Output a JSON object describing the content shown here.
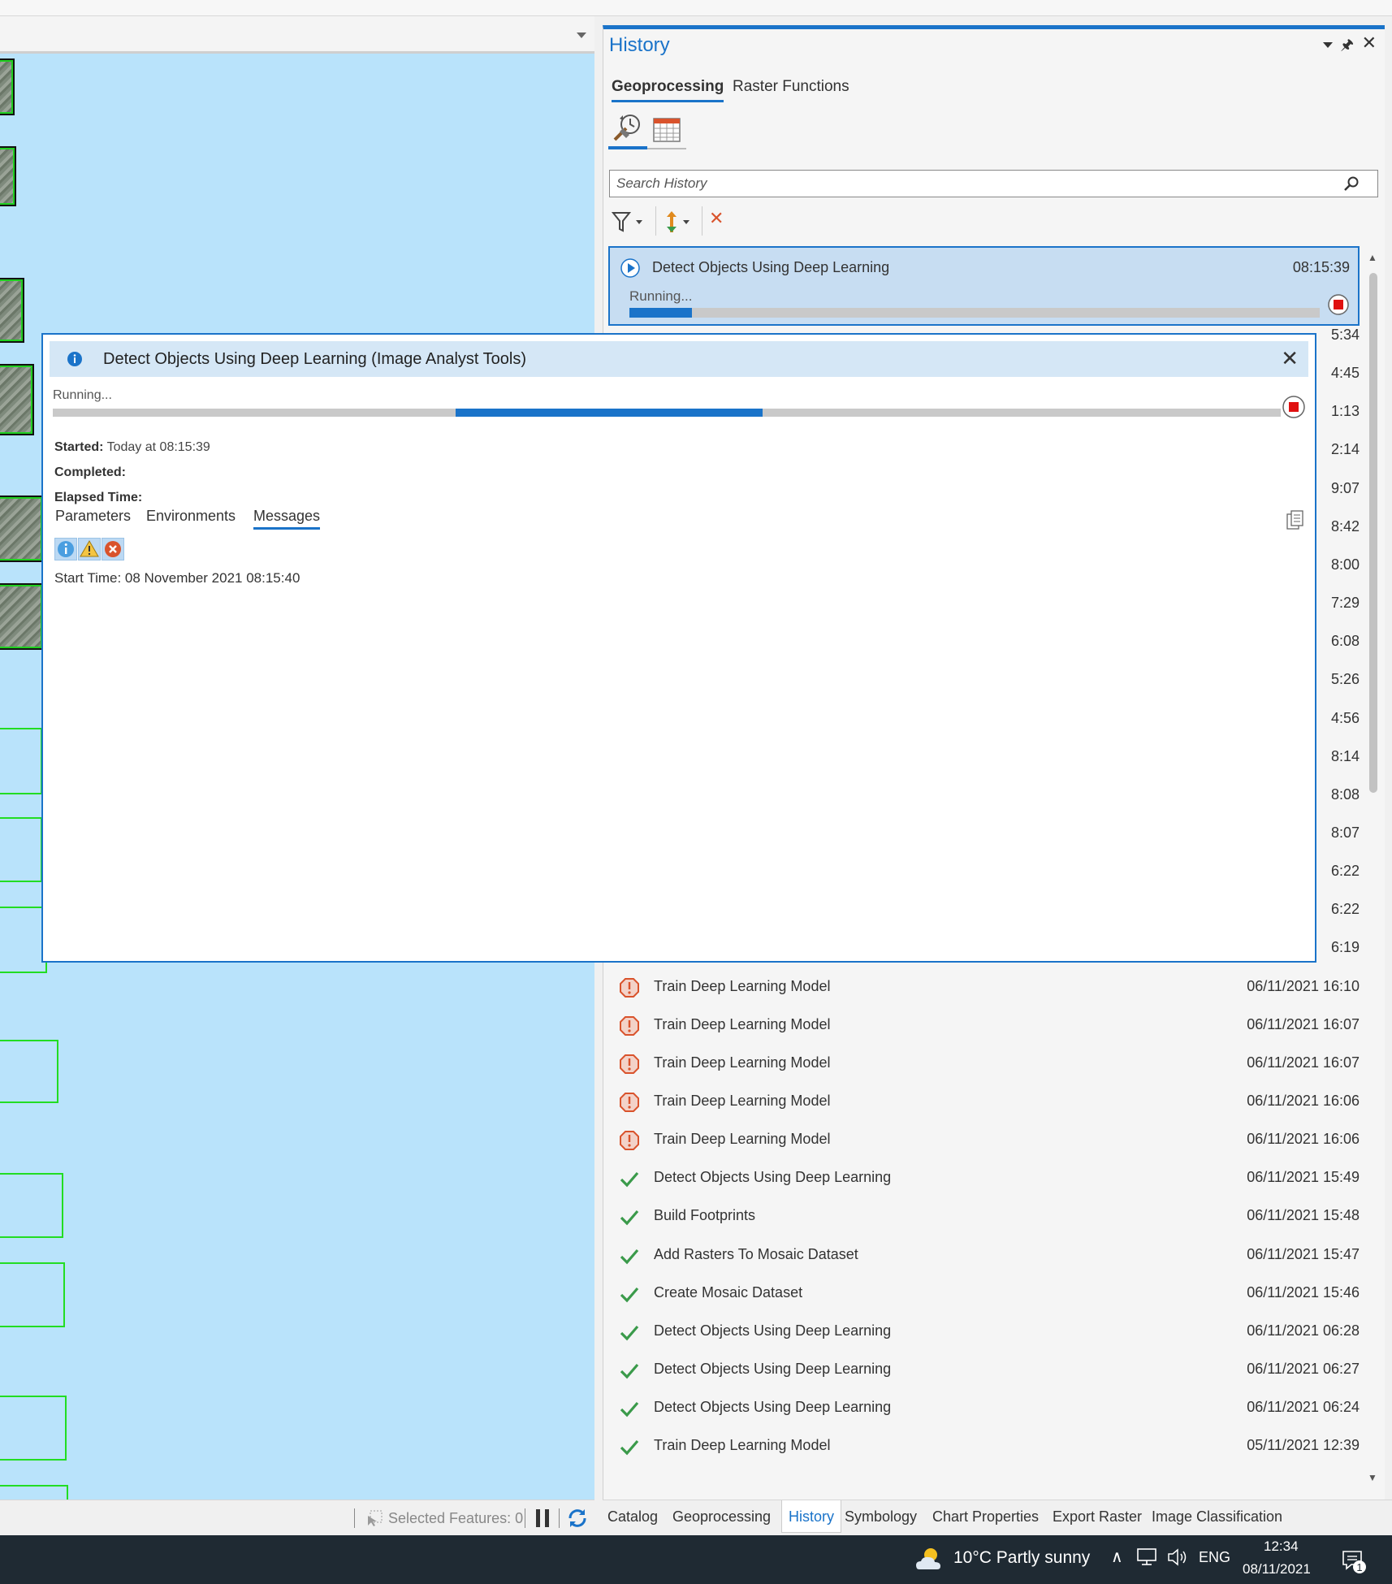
{
  "history": {
    "title": "History",
    "tabs": [
      "Geoprocessing",
      "Raster Functions"
    ],
    "search_placeholder": "Search History",
    "running_item": {
      "name": "Detect Objects Using Deep Learning",
      "time": "08:15:39",
      "status_text": "Running...",
      "progress": 0.09
    },
    "hidden_times": [
      "5:34",
      "4:45",
      "1:13",
      "2:14",
      "9:07",
      "8:42",
      "8:00",
      "7:29",
      "6:08",
      "5:26",
      "4:56",
      "8:14",
      "8:08",
      "8:07",
      "6:22",
      "6:22",
      "6:19"
    ],
    "items": [
      {
        "name": "Train Deep Learning Model",
        "time": "06/11/2021 16:10",
        "status": "error"
      },
      {
        "name": "Train Deep Learning Model",
        "time": "06/11/2021 16:07",
        "status": "error"
      },
      {
        "name": "Train Deep Learning Model",
        "time": "06/11/2021 16:07",
        "status": "error"
      },
      {
        "name": "Train Deep Learning Model",
        "time": "06/11/2021 16:06",
        "status": "error"
      },
      {
        "name": "Train Deep Learning Model",
        "time": "06/11/2021 16:06",
        "status": "error"
      },
      {
        "name": "Detect Objects Using Deep Learning",
        "time": "06/11/2021 15:49",
        "status": "success"
      },
      {
        "name": "Build Footprints",
        "time": "06/11/2021 15:48",
        "status": "success"
      },
      {
        "name": "Add Rasters To Mosaic Dataset",
        "time": "06/11/2021 15:47",
        "status": "success"
      },
      {
        "name": "Create Mosaic Dataset",
        "time": "06/11/2021 15:46",
        "status": "success"
      },
      {
        "name": "Detect Objects Using Deep Learning",
        "time": "06/11/2021 06:28",
        "status": "success"
      },
      {
        "name": "Detect Objects Using Deep Learning",
        "time": "06/11/2021 06:27",
        "status": "success"
      },
      {
        "name": "Detect Objects Using Deep Learning",
        "time": "06/11/2021 06:24",
        "status": "success"
      },
      {
        "name": "Train Deep Learning Model",
        "time": "05/11/2021 12:39",
        "status": "success"
      }
    ]
  },
  "dialog": {
    "title": "Detect Objects Using Deep Learning (Image Analyst Tools)",
    "status_text": "Running...",
    "progress_segment": [
      0.328,
      0.578
    ],
    "started_label": "Started:",
    "started_value": "Today at 08:15:39",
    "completed_label": "Completed:",
    "elapsed_label": "Elapsed Time:",
    "tabs": [
      "Parameters",
      "Environments",
      "Messages"
    ],
    "active_tab": "Messages",
    "message": "Start Time: 08 November 2021 08:15:40"
  },
  "map_footer": {
    "selected_features": "Selected Features: 0"
  },
  "bottom_tabs": [
    "Catalog",
    "Geoprocessing",
    "History",
    "Symbology",
    "Chart Properties",
    "Export Raster",
    "Image Classification"
  ],
  "active_bottom_tab": "History",
  "taskbar": {
    "weather": "10°C  Partly sunny",
    "language": "ENG",
    "time": "12:34",
    "date": "08/11/2021",
    "notifications": "1"
  },
  "colors": {
    "accent": "#1a73c9",
    "map_bg": "#b9e3fb",
    "footprint": "#22dd22",
    "error": "#d9532c",
    "success": "#3a9a4a"
  }
}
